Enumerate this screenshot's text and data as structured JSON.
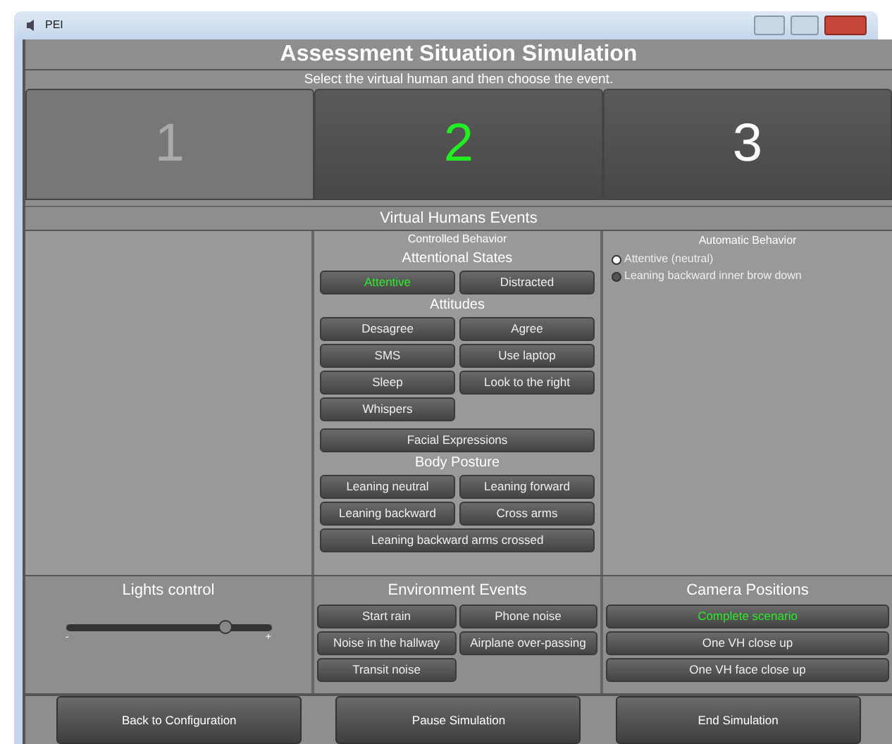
{
  "window": {
    "title": "PEI"
  },
  "header": {
    "title": "Assessment Situation Simulation",
    "subtitle": "Select the virtual human and then choose the event."
  },
  "tabs": [
    {
      "label": "1",
      "selected": false,
      "disabled": true
    },
    {
      "label": "2",
      "selected": true,
      "disabled": false
    },
    {
      "label": "3",
      "selected": false,
      "disabled": false
    }
  ],
  "events": {
    "title": "Virtual Humans Events",
    "controlled": {
      "title": "Controlled Behavior",
      "sections": [
        {
          "title": "Attentional States",
          "buttons": [
            {
              "label": "Attentive",
              "selected": true,
              "wide": false
            },
            {
              "label": "Distracted",
              "selected": false,
              "wide": false
            }
          ]
        },
        {
          "title": "Attitudes",
          "buttons": [
            {
              "label": "Desagree",
              "selected": false,
              "wide": false
            },
            {
              "label": "Agree",
              "selected": false,
              "wide": false
            },
            {
              "label": "SMS",
              "selected": false,
              "wide": false
            },
            {
              "label": "Use laptop",
              "selected": false,
              "wide": false
            },
            {
              "label": "Sleep",
              "selected": false,
              "wide": false
            },
            {
              "label": "Look to the right",
              "selected": false,
              "wide": false
            },
            {
              "label": "Whispers",
              "selected": false,
              "wide": false
            }
          ]
        },
        {
          "buttons": [
            {
              "label": "Facial Expressions",
              "selected": false,
              "wide": true
            }
          ]
        },
        {
          "title": "Body Posture",
          "buttons": [
            {
              "label": "Leaning neutral",
              "selected": false,
              "wide": false
            },
            {
              "label": "Leaning forward",
              "selected": false,
              "wide": false
            },
            {
              "label": "Leaning backward",
              "selected": false,
              "wide": false
            },
            {
              "label": "Cross arms",
              "selected": false,
              "wide": false
            },
            {
              "label": "Leaning backward arms crossed",
              "selected": false,
              "wide": true
            }
          ]
        }
      ]
    },
    "automatic": {
      "title": "Automatic Behavior",
      "options": [
        {
          "label": "Attentive (neutral)",
          "selected": true
        },
        {
          "label": "Leaning backward inner brow down",
          "selected": false
        }
      ]
    }
  },
  "lights": {
    "title": "Lights control",
    "level": 0.78,
    "min_label": "-",
    "max_label": "+"
  },
  "environment": {
    "title": "Environment Events",
    "buttons": [
      {
        "label": "Start rain",
        "selected": false
      },
      {
        "label": "Phone noise",
        "selected": false
      },
      {
        "label": "Noise in the hallway",
        "selected": false
      },
      {
        "label": "Airplane over-passing",
        "selected": false
      },
      {
        "label": "Transit noise",
        "selected": false
      }
    ]
  },
  "camera": {
    "title": "Camera Positions",
    "buttons": [
      {
        "label": "Complete scenario",
        "selected": true
      },
      {
        "label": "One VH close up",
        "selected": false
      },
      {
        "label": "One VH face close up",
        "selected": false
      }
    ]
  },
  "footer": [
    "Back to Configuration",
    "Pause Simulation",
    "End Simulation"
  ]
}
